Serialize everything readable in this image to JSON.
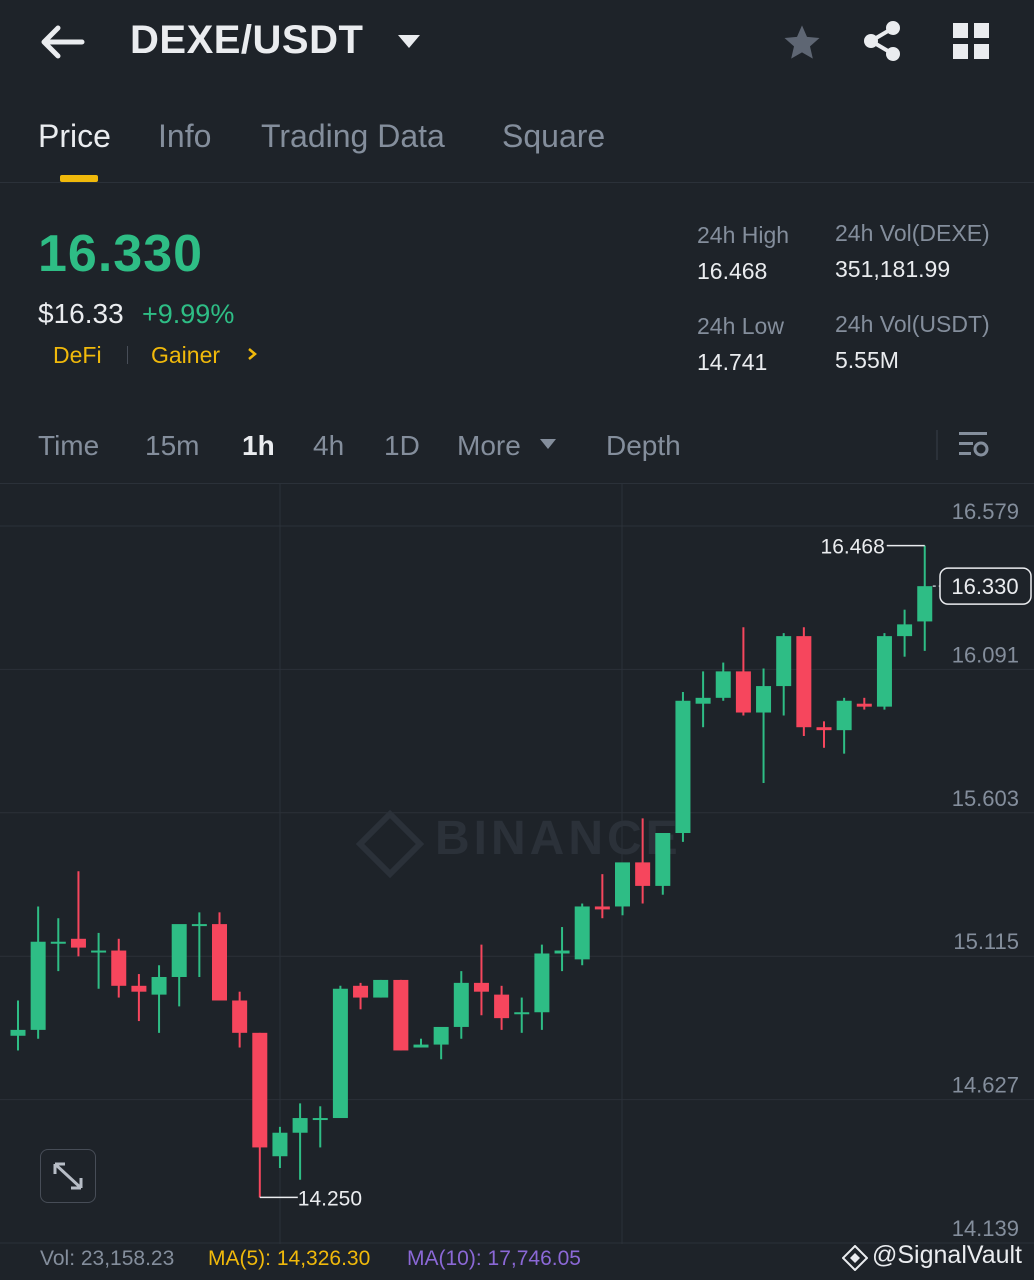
{
  "header": {
    "pair": "DEXE/USDT",
    "icons": [
      "back-arrow-icon",
      "caret-down-icon",
      "star-icon",
      "share-icon",
      "grid-icon"
    ]
  },
  "tabs": [
    {
      "label": "Price",
      "active": true
    },
    {
      "label": "Info",
      "active": false
    },
    {
      "label": "Trading Data",
      "active": false
    },
    {
      "label": "Square",
      "active": false
    }
  ],
  "ticker": {
    "last_price": "16.330",
    "usd_price": "$16.33",
    "change_pct": "+9.99%",
    "tags": [
      "DeFi",
      "Gainer"
    ],
    "high_label": "24h High",
    "high_value": "16.468",
    "low_label": "24h Low",
    "low_value": "14.741",
    "vol_base_label": "24h Vol(DEXE)",
    "vol_base_value": "351,181.99",
    "vol_quote_label": "24h Vol(USDT)",
    "vol_quote_value": "5.55M"
  },
  "timeframes": {
    "items": [
      "Time",
      "15m",
      "1h",
      "4h",
      "1D"
    ],
    "active": "1h",
    "more_label": "More",
    "depth_label": "Depth"
  },
  "colors": {
    "up": "#2ebd85",
    "down": "#f6465d",
    "accent": "#f0b90b",
    "ma10": "#8b68d6",
    "text_muted": "#848e9c"
  },
  "chart_data": {
    "type": "candlestick",
    "y_ticks": [
      "16.579",
      "16.091",
      "15.603",
      "15.115",
      "14.627",
      "14.139"
    ],
    "ylim": [
      14.139,
      16.579
    ],
    "current_price": "16.330",
    "max_label": "16.468",
    "min_label": "14.250",
    "watermark": "BINANCE",
    "candles": [
      {
        "o": 14.8,
        "h": 14.92,
        "l": 14.75,
        "c": 14.82
      },
      {
        "o": 14.82,
        "h": 15.24,
        "l": 14.79,
        "c": 15.12
      },
      {
        "o": 15.12,
        "h": 15.2,
        "l": 15.02,
        "c": 15.12
      },
      {
        "o": 15.13,
        "h": 15.36,
        "l": 15.07,
        "c": 15.1
      },
      {
        "o": 15.09,
        "h": 15.15,
        "l": 14.96,
        "c": 15.09
      },
      {
        "o": 15.09,
        "h": 15.13,
        "l": 14.93,
        "c": 14.97
      },
      {
        "o": 14.97,
        "h": 15.01,
        "l": 14.85,
        "c": 14.95
      },
      {
        "o": 14.94,
        "h": 15.04,
        "l": 14.81,
        "c": 15.0
      },
      {
        "o": 15.0,
        "h": 15.05,
        "l": 14.9,
        "c": 15.18
      },
      {
        "o": 15.18,
        "h": 15.22,
        "l": 15.0,
        "c": 15.18
      },
      {
        "o": 15.18,
        "h": 15.22,
        "l": 14.92,
        "c": 14.92
      },
      {
        "o": 14.92,
        "h": 14.95,
        "l": 14.76,
        "c": 14.81
      },
      {
        "o": 14.81,
        "h": 14.81,
        "l": 14.25,
        "c": 14.42
      },
      {
        "o": 14.39,
        "h": 14.49,
        "l": 14.35,
        "c": 14.47
      },
      {
        "o": 14.47,
        "h": 14.57,
        "l": 14.31,
        "c": 14.52
      },
      {
        "o": 14.52,
        "h": 14.56,
        "l": 14.42,
        "c": 14.52
      },
      {
        "o": 14.52,
        "h": 14.97,
        "l": 14.52,
        "c": 14.96
      },
      {
        "o": 14.97,
        "h": 14.98,
        "l": 14.89,
        "c": 14.93
      },
      {
        "o": 14.93,
        "h": 14.99,
        "l": 14.93,
        "c": 14.99
      },
      {
        "o": 14.99,
        "h": 14.99,
        "l": 14.75,
        "c": 14.75
      },
      {
        "o": 14.76,
        "h": 14.79,
        "l": 14.76,
        "c": 14.77
      },
      {
        "o": 14.77,
        "h": 14.81,
        "l": 14.72,
        "c": 14.83
      },
      {
        "o": 14.83,
        "h": 15.02,
        "l": 14.79,
        "c": 14.98
      },
      {
        "o": 14.98,
        "h": 15.11,
        "l": 14.87,
        "c": 14.95
      },
      {
        "o": 14.94,
        "h": 14.97,
        "l": 14.82,
        "c": 14.86
      },
      {
        "o": 14.88,
        "h": 14.93,
        "l": 14.81,
        "c": 14.88
      },
      {
        "o": 14.88,
        "h": 15.11,
        "l": 14.82,
        "c": 15.08
      },
      {
        "o": 15.08,
        "h": 15.17,
        "l": 15.02,
        "c": 15.09
      },
      {
        "o": 15.06,
        "h": 15.25,
        "l": 15.04,
        "c": 15.24
      },
      {
        "o": 15.24,
        "h": 15.35,
        "l": 15.2,
        "c": 15.23
      },
      {
        "o": 15.24,
        "h": 15.32,
        "l": 15.21,
        "c": 15.39
      },
      {
        "o": 15.39,
        "h": 15.54,
        "l": 15.25,
        "c": 15.31
      },
      {
        "o": 15.31,
        "h": 15.47,
        "l": 15.28,
        "c": 15.49
      },
      {
        "o": 15.49,
        "h": 15.97,
        "l": 15.46,
        "c": 15.94
      },
      {
        "o": 15.93,
        "h": 16.04,
        "l": 15.85,
        "c": 15.95
      },
      {
        "o": 15.95,
        "h": 16.07,
        "l": 15.94,
        "c": 16.04
      },
      {
        "o": 16.04,
        "h": 16.19,
        "l": 15.89,
        "c": 15.9
      },
      {
        "o": 15.9,
        "h": 16.05,
        "l": 15.66,
        "c": 15.99
      },
      {
        "o": 15.99,
        "h": 16.17,
        "l": 15.89,
        "c": 16.16
      },
      {
        "o": 16.16,
        "h": 16.19,
        "l": 15.82,
        "c": 15.85
      },
      {
        "o": 15.85,
        "h": 15.87,
        "l": 15.78,
        "c": 15.84
      },
      {
        "o": 15.84,
        "h": 15.95,
        "l": 15.76,
        "c": 15.94
      },
      {
        "o": 15.93,
        "h": 15.95,
        "l": 15.91,
        "c": 15.92
      },
      {
        "o": 15.92,
        "h": 16.17,
        "l": 15.91,
        "c": 16.16
      },
      {
        "o": 16.16,
        "h": 16.25,
        "l": 16.09,
        "c": 16.2
      },
      {
        "o": 16.21,
        "h": 16.468,
        "l": 16.11,
        "c": 16.33
      }
    ]
  },
  "footer": {
    "vol": "Vol: 23,158.23",
    "ma5": "MA(5): 14,326.30",
    "ma10": "MA(10): 17,746.05",
    "credit": "@SignalVault"
  }
}
